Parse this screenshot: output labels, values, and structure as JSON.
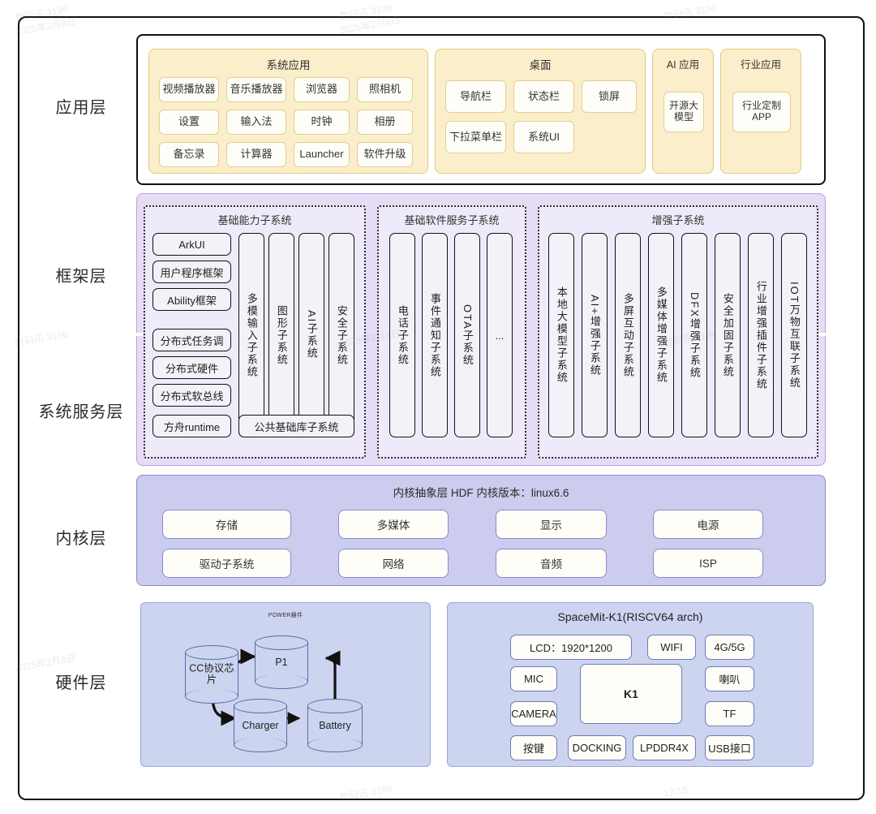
{
  "layers": [
    {
      "label": "应用层"
    },
    {
      "label": "框架层"
    },
    {
      "label": "系统服务层"
    },
    {
      "label": "内核层"
    },
    {
      "label": "硬件层"
    }
  ],
  "application_layer": {
    "groups": [
      {
        "title": "系统应用",
        "items": [
          "视频播放器",
          "音乐播放器",
          "浏览器",
          "照相机",
          "设置",
          "输入法",
          "时钟",
          "相册",
          "备忘录",
          "计算器",
          "Launcher",
          "软件升级"
        ]
      },
      {
        "title": "桌面",
        "items": [
          "导航栏",
          "状态栏",
          "锁屏",
          "下拉菜单栏",
          "系统UI"
        ]
      },
      {
        "title": "AI 应用",
        "items": [
          "开源大模型"
        ]
      },
      {
        "title": "行业应用",
        "items": [
          "行业定制APP"
        ]
      }
    ]
  },
  "framework_layer": {
    "basic_capability": {
      "title": "基础能力子系统",
      "left_items": [
        "ArkUI",
        "用户程序框架",
        "Ability框架",
        "分布式任务调",
        "分布式硬件",
        "分布式软总线",
        "方舟runtime"
      ],
      "vertical_items": [
        "多模输入子系统",
        "图形子系统",
        "AI子系统",
        "安全子系统"
      ],
      "bottom_item": "公共基础库子系统"
    },
    "basic_software_service": {
      "title": "基础软件服务子系统",
      "vertical_items": [
        "电话子系统",
        "事件通知子系统",
        "OTA子系统",
        "..."
      ]
    },
    "enhancement": {
      "title": "增强子系统",
      "vertical_items": [
        "本地大模型子系统",
        "AI+增强子系统",
        "多屏互动子系统",
        "多媒体增强子系统",
        "DFX增强子系统",
        "安全加固子系统",
        "行业增强插件子系统",
        "IOT万物互联子系统"
      ]
    }
  },
  "kernel_layer": {
    "title": "内核抽象层  HDF   内核版本：linux6.6",
    "items": [
      "存储",
      "多媒体",
      "显示",
      "电源",
      "驱动子系统",
      "网络",
      "音频",
      "ISP"
    ]
  },
  "hardware_layer": {
    "power": {
      "title": "POWER器件",
      "nodes": [
        {
          "id": "cc",
          "label": "CC协议芯片"
        },
        {
          "id": "p1",
          "label": "P1"
        },
        {
          "id": "charger",
          "label": "Charger"
        },
        {
          "id": "battery",
          "label": "Battery"
        }
      ],
      "edges": [
        {
          "from": "cc",
          "to": "p1"
        },
        {
          "from": "cc",
          "to": "charger"
        },
        {
          "from": "charger",
          "to": "battery"
        },
        {
          "from": "battery",
          "to": "p1"
        }
      ]
    },
    "soc": {
      "title": "SpaceMit-K1(RISCV64 arch)",
      "items": [
        "LCD：1920*1200",
        "WIFI",
        "4G/5G",
        "MIC",
        "K1",
        "喇叭",
        "CAMERA",
        "TF",
        "按键",
        "DOCKING",
        "LPDDR4X",
        "USB接口"
      ]
    }
  },
  "colors": {
    "app_group_bg": "#fbeecb",
    "app_group_border": "#e2c97e",
    "framework_bg": "#e6dcf6",
    "framework_border": "#b6a4e0",
    "kernel_bg": "#ccccee",
    "kernel_border": "#8b8bd0",
    "hardware_bg": "#cdd4ef",
    "hardware_border": "#9aa6d8",
    "chip_bg": "#fffdf7",
    "outline": "#111111"
  },
  "watermarks": [
    "数码讯 3196",
    "2025年2月8日",
    "17:18"
  ]
}
